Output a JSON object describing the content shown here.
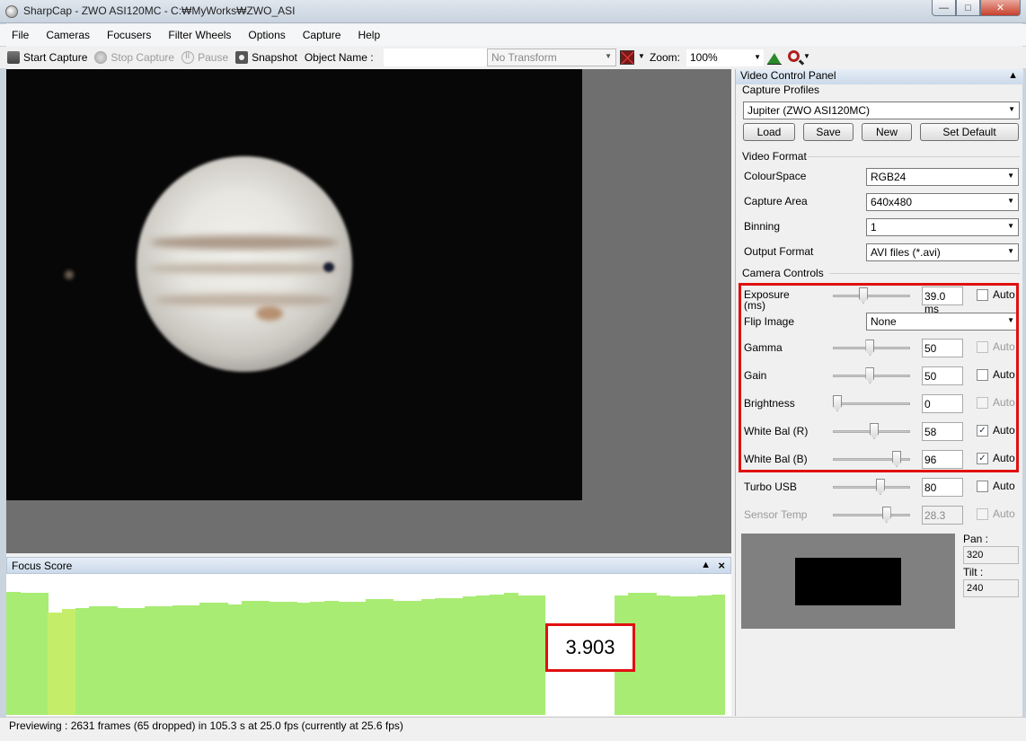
{
  "window": {
    "title": "SharpCap - ZWO ASI120MC - C:₩MyWorks₩ZWO_ASI"
  },
  "menu": [
    "File",
    "Cameras",
    "Focusers",
    "Filter Wheels",
    "Options",
    "Capture",
    "Help"
  ],
  "toolbar": {
    "start_capture": "Start Capture",
    "stop_capture": "Stop Capture",
    "pause": "Pause",
    "snapshot": "Snapshot",
    "object_name_label": "Object Name :",
    "object_name_value": "",
    "transform": "No Transform",
    "zoom_label": "Zoom:",
    "zoom_value": "100%"
  },
  "focus_panel": {
    "title": "Focus Score",
    "score": "3.903",
    "chart_data": {
      "type": "bar",
      "values": [
        100,
        99,
        99,
        83,
        86,
        87,
        88,
        88,
        87,
        87,
        88,
        88,
        89,
        89,
        91,
        91,
        90,
        93,
        93,
        92,
        92,
        91,
        92,
        93,
        92,
        92,
        94,
        94,
        93,
        93,
        94,
        95,
        95,
        96,
        97,
        98,
        99,
        97,
        97,
        0,
        0,
        0,
        0,
        0,
        97,
        99,
        99,
        97,
        96,
        96,
        97,
        98
      ]
    }
  },
  "status": {
    "text": "Previewing : 2631 frames (65 dropped) in 105.3 s at 25.0 fps  (currently at 25.6 fps)"
  },
  "panel": {
    "title": "Video Control Panel",
    "capture_profiles": {
      "label": "Capture Profiles",
      "selected": "Jupiter (ZWO ASI120MC)",
      "buttons": [
        "Load",
        "Save",
        "New",
        "Set Default"
      ]
    },
    "video_format": {
      "label": "Video Format",
      "colourspace_label": "ColourSpace",
      "colourspace": "RGB24",
      "capture_area_label": "Capture Area",
      "capture_area": "640x480",
      "binning_label": "Binning",
      "binning": "1",
      "output_format_label": "Output Format",
      "output_format": "AVI files (*.avi)"
    },
    "camera_controls": {
      "label": "Camera Controls",
      "exposure_label": "Exposure\n(ms)",
      "exposure_line1": "Exposure",
      "exposure_line2": "(ms)",
      "exposure": "39.0 ms",
      "flip_label": "Flip Image",
      "flip": "None",
      "gamma_label": "Gamma",
      "gamma": "50",
      "gain_label": "Gain",
      "gain": "50",
      "brightness_label": "Brightness",
      "brightness": "0",
      "wbr_label": "White Bal (R)",
      "wbr": "58",
      "wbb_label": "White Bal (B)",
      "wbb": "96",
      "turbo_label": "Turbo USB",
      "turbo": "80",
      "temp_label": "Sensor Temp",
      "temp": "28.3",
      "auto_label": "Auto",
      "slider_levels": {
        "exposure": 0.38,
        "gamma": 0.48,
        "gain": 0.48,
        "brightness": 0.0,
        "wbr": 0.54,
        "wbb": 0.87,
        "turbo": 0.63,
        "temp": 0.72
      }
    },
    "pan_label": "Pan :",
    "pan": "320",
    "tilt_label": "Tilt :",
    "tilt": "240"
  }
}
